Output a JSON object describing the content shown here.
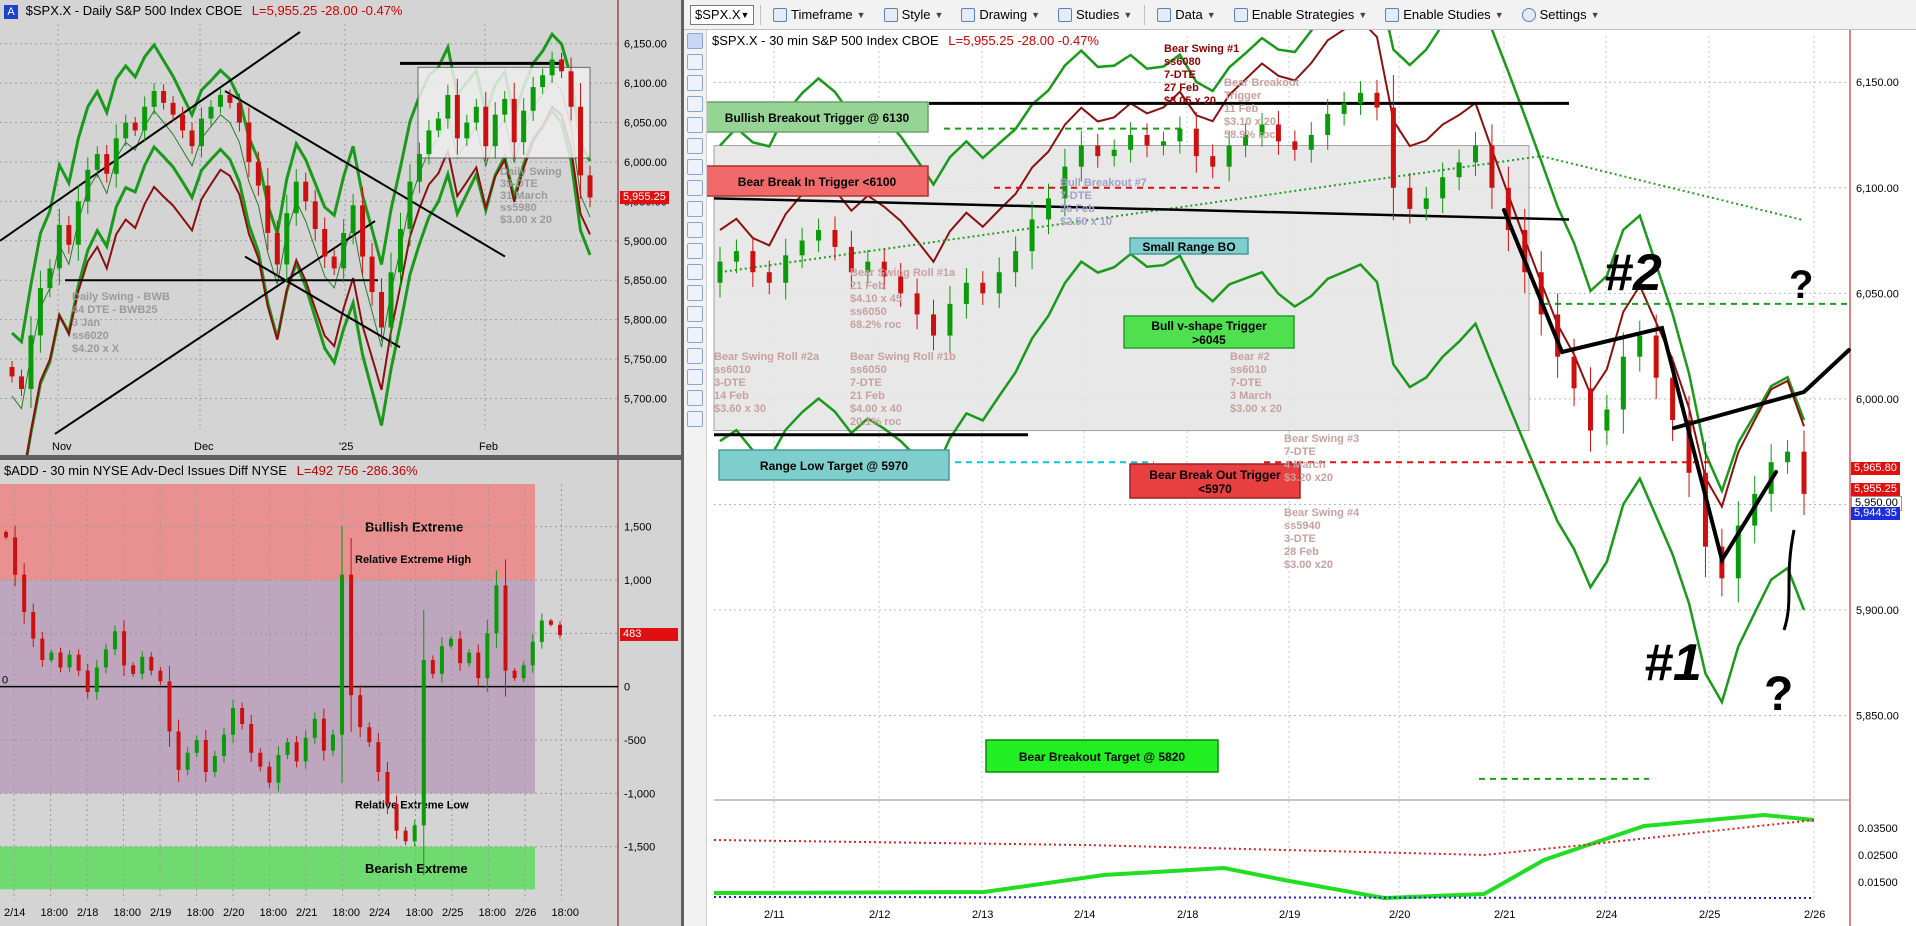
{
  "daily": {
    "title_badge": "A",
    "title": "$SPX.X - Daily  S&P 500 Index  CBOE",
    "quote": "L=5,955.25  -28.00  -0.47%",
    "last_tag": "5,955.25",
    "annotations": [
      {
        "id": "daily-swing-bwb",
        "lines": [
          "Daily Swing - BWB",
          "44 DTE - BWB25",
          "3 Jan",
          "ss6020",
          "$4.20 x X"
        ]
      },
      {
        "id": "daily-swing-35",
        "lines": [
          "Daily Swing",
          "35-DTE",
          "31 March",
          "ss5980",
          "$3.00 x 20"
        ]
      }
    ]
  },
  "add": {
    "title": "$ADD - 30 min  NYSE Adv-Decl Issues Diff  NYSE",
    "quote": "L=492  756  -286.36%",
    "last_tag": "483",
    "zones": {
      "top": "Bullish Extreme",
      "bottom": "Bearish Extreme"
    },
    "labels": {
      "high": "Relative Extreme High",
      "low": "Relative Extreme Low"
    },
    "zero_label": "0"
  },
  "toolbar": {
    "symbol": "$SPX.X",
    "items": [
      "Timeframe",
      "Style",
      "Drawing",
      "Studies",
      "Data",
      "Enable Strategies",
      "Enable Studies",
      "Settings"
    ]
  },
  "spx30": {
    "title": "$SPX.X - 30 min  S&P 500 Index  CBOE",
    "quote": "L=5,955.25  -28.00  -0.47%",
    "boxes": {
      "bull_breakout_trigger": "Bullish Breakout Trigger @ 6130",
      "bear_break_in_trigger": "Bear Break In Trigger <6100",
      "range_low_target": "Range Low Target @ 5970",
      "small_range_bo": "Small Range BO",
      "bull_vshape": [
        "Bull v-shape Trigger",
        ">6045"
      ],
      "bear_breakout_trigger": [
        "Bear Break Out Trigger",
        "<5970"
      ],
      "bear_breakout_target": "Bear Breakout Target @ 5820"
    },
    "annotations": [
      {
        "id": "bear-swing-1",
        "lines": [
          "Bear Swing #1",
          "ss6080",
          "7-DTE",
          "27 Feb",
          "$3.05 x 20"
        ]
      },
      {
        "id": "bear-breakout-faded",
        "lines": [
          "Bear Breakout",
          "Trigger",
          "11 Feb",
          "$3.10 x 20",
          "58.9% roc"
        ]
      },
      {
        "id": "bull-breakout-7",
        "lines": [
          "Bull Breakout #7",
          "7-DTE",
          "26 Feb",
          "$2.50 x 10"
        ]
      },
      {
        "id": "bear-swing-roll-1a",
        "lines": [
          "Bear Swing Roll #1a",
          "21 Feb",
          "$4.10 x 45",
          "ss6050",
          "68.2% roc"
        ]
      },
      {
        "id": "bear-swing-roll-2a",
        "lines": [
          "Bear Swing Roll #2a",
          "ss6010",
          "3-DTE",
          "14 Feb",
          "$3.60 x 30"
        ]
      },
      {
        "id": "bear-swing-roll-1b",
        "lines": [
          "Bear Swing Roll #1b",
          "ss6050",
          "7-DTE",
          "21 Feb",
          "$4.00 x 40",
          "20.1% roc"
        ]
      },
      {
        "id": "bear-2",
        "lines": [
          "Bear #2",
          "ss6010",
          "7-DTE",
          "3 March",
          "$3.00 x 20"
        ]
      },
      {
        "id": "bear-swing-3",
        "lines": [
          "Bear Swing #3",
          "7-DTE",
          "4 March",
          "$3.20 x20"
        ]
      },
      {
        "id": "bear-swing-4",
        "lines": [
          "Bear Swing #4",
          "ss5940",
          "3-DTE",
          "28 Feb",
          "$3.00 x20"
        ]
      }
    ],
    "hand_labels": {
      "two": "#2",
      "one": "#1",
      "q": "?"
    },
    "price_tags": {
      "p1": "5,965.80",
      "p2": "5,955.25",
      "p3": "5,950.00",
      "p4": "5,944.35"
    },
    "osc_axis": [
      "0.03500",
      "0.02500",
      "0.01500"
    ]
  },
  "chart_data": [
    {
      "type": "candlestick",
      "title": "$SPX.X - Daily  S&P 500 Index  CBOE",
      "x_ticks": [
        "Nov",
        "Dec",
        "'25",
        "Feb"
      ],
      "y_ticks": [
        5700,
        5750,
        5800,
        5850,
        5900,
        5950,
        6000,
        6050,
        6100,
        6150
      ],
      "ylim": [
        5660,
        6175
      ],
      "series_close": [
        5728,
        5712,
        5780,
        5840,
        5865,
        5920,
        5895,
        5950,
        5990,
        6010,
        5985,
        6030,
        6050,
        6040,
        6070,
        6090,
        6075,
        6060,
        6040,
        6020,
        6055,
        6070,
        6085,
        6075,
        6050,
        6000,
        5970,
        5910,
        5870,
        5935,
        5975,
        5950,
        5915,
        5880,
        5865,
        5910,
        5945,
        5880,
        5835,
        5790,
        5860,
        5915,
        5975,
        6010,
        6040,
        6055,
        6085,
        6030,
        6050,
        6070,
        6020,
        6060,
        6080,
        6025,
        6065,
        6095,
        6110,
        6130,
        6115,
        6070,
        5983,
        5955
      ],
      "last": 5955.25
    },
    {
      "type": "bar",
      "title": "$ADD - 30 min  NYSE Adv-Decl Issues Diff  NYSE",
      "x_ticks": [
        "2/14",
        "18:00",
        "2/18",
        "18:00",
        "2/19",
        "18:00",
        "2/20",
        "18:00",
        "2/21",
        "18:00",
        "2/24",
        "18:00",
        "2/25",
        "18:00",
        "2/26",
        "18:00"
      ],
      "y_ticks": [
        -1500,
        -1000,
        -500,
        0,
        500,
        1000,
        1500
      ],
      "ylim": [
        -2000,
        1900
      ],
      "values": [
        1400,
        1050,
        700,
        450,
        250,
        320,
        180,
        300,
        150,
        -50,
        180,
        350,
        520,
        200,
        120,
        280,
        150,
        50,
        -420,
        -780,
        -620,
        -500,
        -800,
        -650,
        -450,
        -200,
        -350,
        -620,
        -750,
        -900,
        -640,
        -520,
        -700,
        -480,
        -300,
        -600,
        -450,
        1050,
        -80,
        -380,
        -520,
        -800,
        -1100,
        -1350,
        -1450,
        -1300,
        250,
        120,
        380,
        450,
        220,
        320,
        80,
        500,
        950,
        150,
        80,
        200,
        420,
        620,
        580,
        483
      ],
      "last": 483
    },
    {
      "type": "candlestick",
      "title": "$SPX.X - 30 min  S&P 500 Index  CBOE",
      "x_ticks": [
        "2/11",
        "2/12",
        "2/13",
        "2/14",
        "2/18",
        "2/19",
        "2/20",
        "2/21",
        "2/24",
        "2/25",
        "2/26"
      ],
      "y_ticks": [
        5850,
        5900,
        5950,
        6000,
        6050,
        6100,
        6150
      ],
      "ylim": [
        5810,
        6170
      ],
      "series_close": [
        6065,
        6070,
        6060,
        6055,
        6068,
        6075,
        6080,
        6072,
        6060,
        6065,
        6058,
        6050,
        6040,
        6030,
        6045,
        6055,
        6050,
        6060,
        6070,
        6085,
        6095,
        6110,
        6120,
        6115,
        6118,
        6125,
        6120,
        6122,
        6128,
        6115,
        6110,
        6120,
        6125,
        6130,
        6122,
        6118,
        6125,
        6135,
        6140,
        6145,
        6138,
        6100,
        6090,
        6095,
        6105,
        6112,
        6120,
        6100,
        6080,
        6060,
        6040,
        6020,
        6005,
        5985,
        5995,
        6020,
        6030,
        6010,
        5990,
        5965,
        5930,
        5915,
        5940,
        5955,
        5970,
        5975,
        5955
      ],
      "last": 5955.25
    }
  ]
}
